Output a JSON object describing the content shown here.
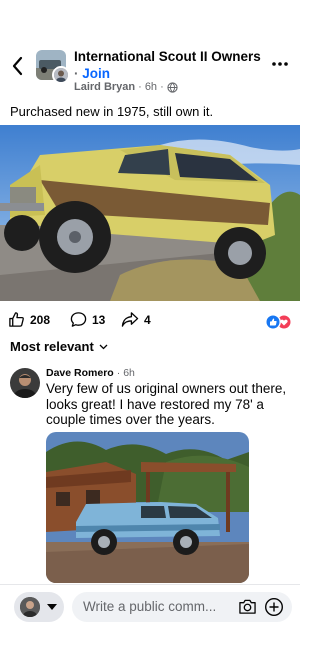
{
  "header": {
    "group_name": "International Scout II Owners",
    "separator": "·",
    "join_label": "Join",
    "author": "Laird Bryan",
    "time": "6h",
    "dot": "·"
  },
  "post": {
    "text": "Purchased new in 1975, still own it."
  },
  "reactions": {
    "count": "208",
    "comments": "13",
    "shares": "4"
  },
  "sort": {
    "label": "Most relevant"
  },
  "comment": {
    "author": "Dave Romero",
    "dot": "·",
    "time": "6h",
    "text": "Very few of us original owners out there, looks great! I have restored my 78' a couple times over the years."
  },
  "composer": {
    "placeholder": "Write a public comm..."
  },
  "colors": {
    "accent": "#0866ff",
    "like": "#1877f2",
    "love": "#f33e58",
    "secondary_text": "#65676b"
  }
}
